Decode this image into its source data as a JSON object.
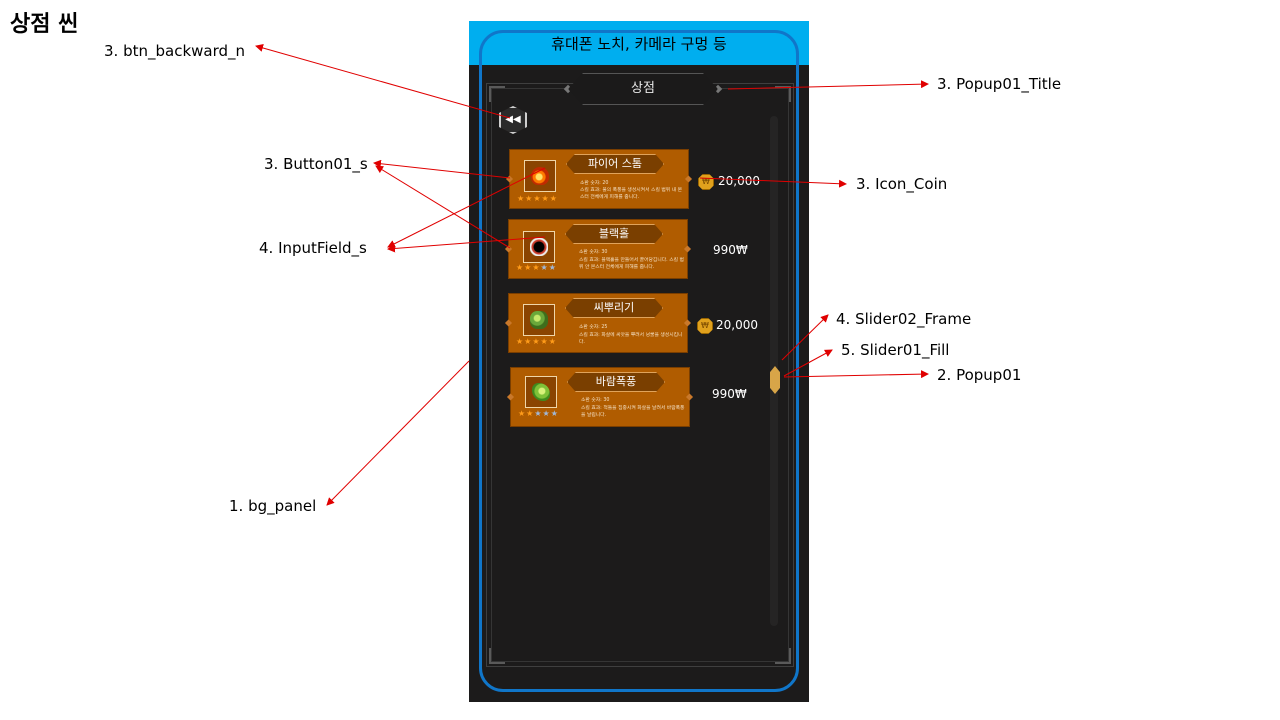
{
  "page_title": "상점 씬",
  "notch_label": "휴대폰 노치, 카메라 구멍 등",
  "popup": {
    "title": "상점",
    "back_icon_glyph": "◀◀"
  },
  "items": [
    {
      "name": "파이어 스톰",
      "stat": "소환 숫자: 20",
      "desc": "스킬 효과: 불의 폭풍을 생성시켜서 스킬 범위 내 몬스터 전체에게 피해를 줍니다.",
      "stars_on": 5,
      "stars_total": 5,
      "price": "20,000",
      "currency": "coin",
      "thumb": "fire-storm-icon"
    },
    {
      "name": "블랙홀",
      "stat": "소환 숫자: 30",
      "desc": "스킬 효과: 블랙홀을 만들어서 끌어당깁니다. 스킬 범위 안 몬스터 전체에게 피해를 줍니다.",
      "stars_on": 3,
      "stars_total": 5,
      "price": "990₩",
      "currency": "cash",
      "thumb": "black-hole-icon"
    },
    {
      "name": "씨뿌리기",
      "stat": "소환 숫자: 25",
      "desc": "스킬 효과: 화살에 씨앗을 뿌려서 넝쿨을 생성시킵니다.",
      "stars_on": 5,
      "stars_total": 5,
      "price": "20,000",
      "currency": "coin",
      "thumb": "seed-icon"
    },
    {
      "name": "바람폭풍",
      "stat": "소환 숫자: 30",
      "desc": "스킬 효과: 적들을 집중시켜 화살을 날려서 바람폭풍을 날립니다.",
      "stars_on": 2,
      "stars_total": 5,
      "price": "990₩",
      "currency": "cash",
      "thumb": "wind-storm-icon"
    }
  ],
  "annotations": {
    "btn_backward": "3. btn_backward_n",
    "popup_title": "3. Popup01_Title",
    "button01": "3. Button01_s",
    "icon_coin": "3. Icon_Coin",
    "inputfield": "4. InputField_s",
    "slider_frame": "4. Slider02_Frame",
    "slider_fill": "5. Slider01_Fill",
    "popup01": "2. Popup01",
    "bg_panel": "1. bg_panel"
  },
  "colors": {
    "notch": "#00aeef",
    "phone_outline": "#1076c9",
    "panel_bg": "#1c1b1b",
    "item_bg": "#b05c00",
    "coin": "#e0a11d",
    "slider_fill": "#d8a548",
    "arrow": "#e00000"
  }
}
